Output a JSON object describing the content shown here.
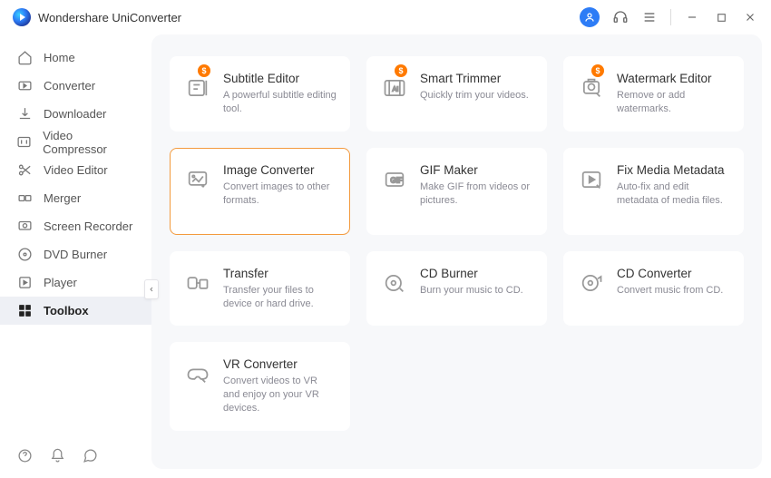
{
  "app": {
    "title": "Wondershare UniConverter"
  },
  "sidebar": {
    "items": [
      {
        "label": "Home"
      },
      {
        "label": "Converter"
      },
      {
        "label": "Downloader"
      },
      {
        "label": "Video Compressor"
      },
      {
        "label": "Video Editor"
      },
      {
        "label": "Merger"
      },
      {
        "label": "Screen Recorder"
      },
      {
        "label": "DVD Burner"
      },
      {
        "label": "Player"
      },
      {
        "label": "Toolbox"
      }
    ],
    "active_index": 9
  },
  "tools": [
    {
      "title": "Subtitle Editor",
      "desc": "A powerful subtitle editing tool.",
      "badge": "$"
    },
    {
      "title": "Smart Trimmer",
      "desc": "Quickly trim your videos.",
      "badge": "$"
    },
    {
      "title": "Watermark Editor",
      "desc": "Remove or add watermarks.",
      "badge": "$"
    },
    {
      "title": "Image Converter",
      "desc": "Convert images to other formats.",
      "selected": true
    },
    {
      "title": "GIF Maker",
      "desc": "Make GIF from videos or pictures."
    },
    {
      "title": "Fix Media Metadata",
      "desc": "Auto-fix and edit metadata of media files."
    },
    {
      "title": "Transfer",
      "desc": "Transfer your files to device or hard drive."
    },
    {
      "title": "CD Burner",
      "desc": "Burn your music to CD."
    },
    {
      "title": "CD Converter",
      "desc": "Convert music from CD."
    },
    {
      "title": "VR Converter",
      "desc": "Convert videos to VR and enjoy on your VR devices."
    }
  ]
}
